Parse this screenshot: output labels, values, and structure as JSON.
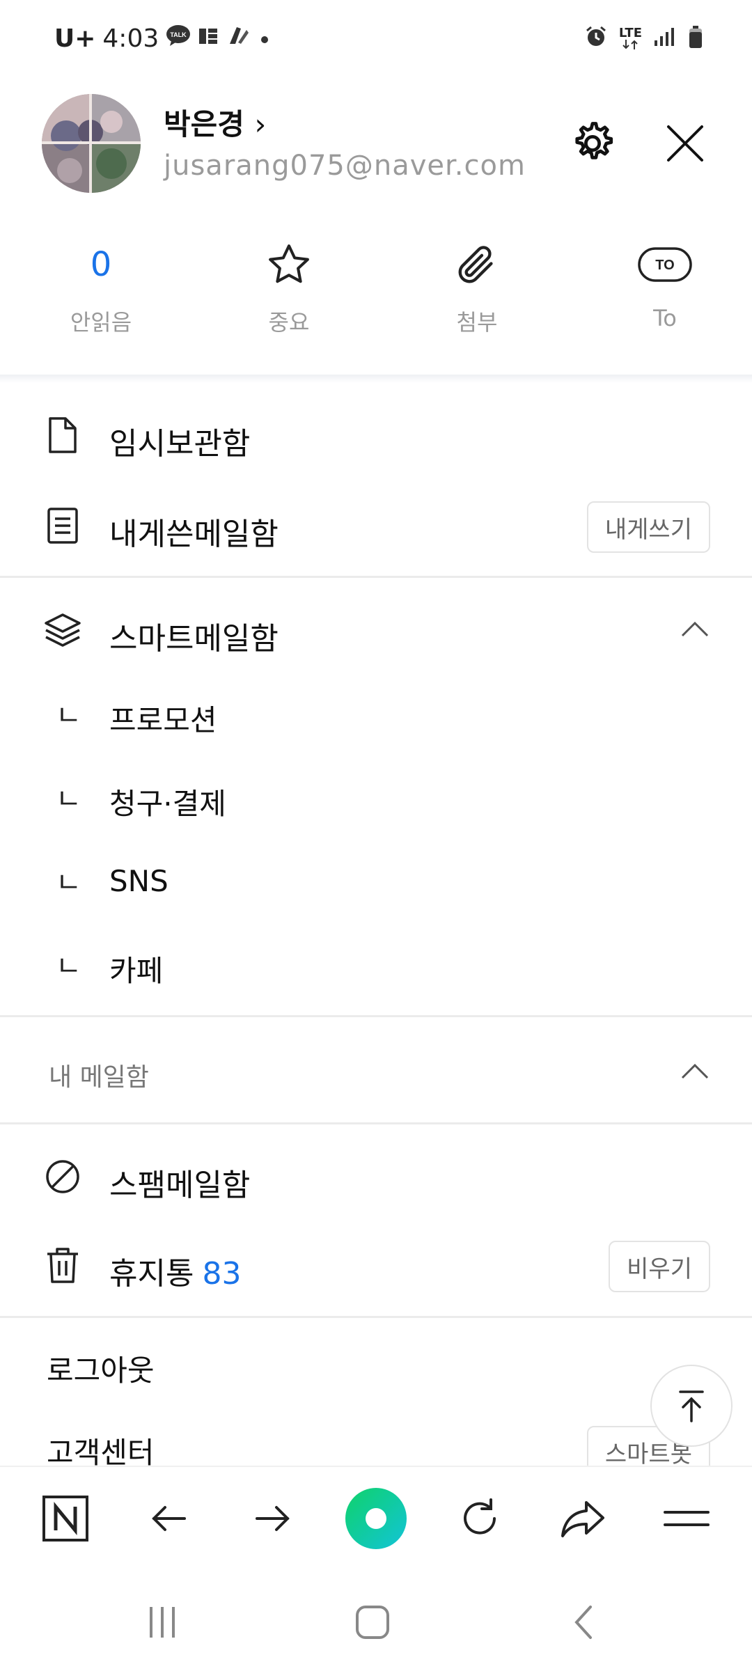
{
  "status_bar": {
    "carrier": "U+",
    "time": "4:03",
    "network": "LTE",
    "icons": [
      "talk-icon",
      "news-icon",
      "app-icon",
      "dot-icon",
      "alarm-icon",
      "lte-icon",
      "signal-icon",
      "battery-icon"
    ]
  },
  "profile": {
    "name": "박은경",
    "chevron": "›",
    "email": "jusarang075@naver.com"
  },
  "quick": [
    {
      "value": "0",
      "label": "안읽음",
      "icon": "count"
    },
    {
      "label": "중요",
      "icon": "star-icon"
    },
    {
      "label": "첨부",
      "icon": "paperclip-icon"
    },
    {
      "label": "To",
      "icon": "to-icon",
      "badge": "TO"
    }
  ],
  "folders": {
    "drafts": "임시보관함",
    "sent_to_me": "내게쓴메일함",
    "write_to_me_button": "내게쓰기"
  },
  "smart": {
    "title": "스마트메일함",
    "sub_mark": "ㄴ",
    "items": [
      "프로모션",
      "청구·결제",
      "SNS",
      "카페"
    ]
  },
  "my_mailbox": {
    "title": "내 메일함"
  },
  "spam": "스팸메일함",
  "trash": {
    "label": "휴지통",
    "count": "83",
    "empty_button": "비우기"
  },
  "logout": "로그아웃",
  "support": {
    "label": "고객센터",
    "button": "스마트봇"
  },
  "colors": {
    "accent": "#1a73e8",
    "green": "#1ec87a"
  }
}
